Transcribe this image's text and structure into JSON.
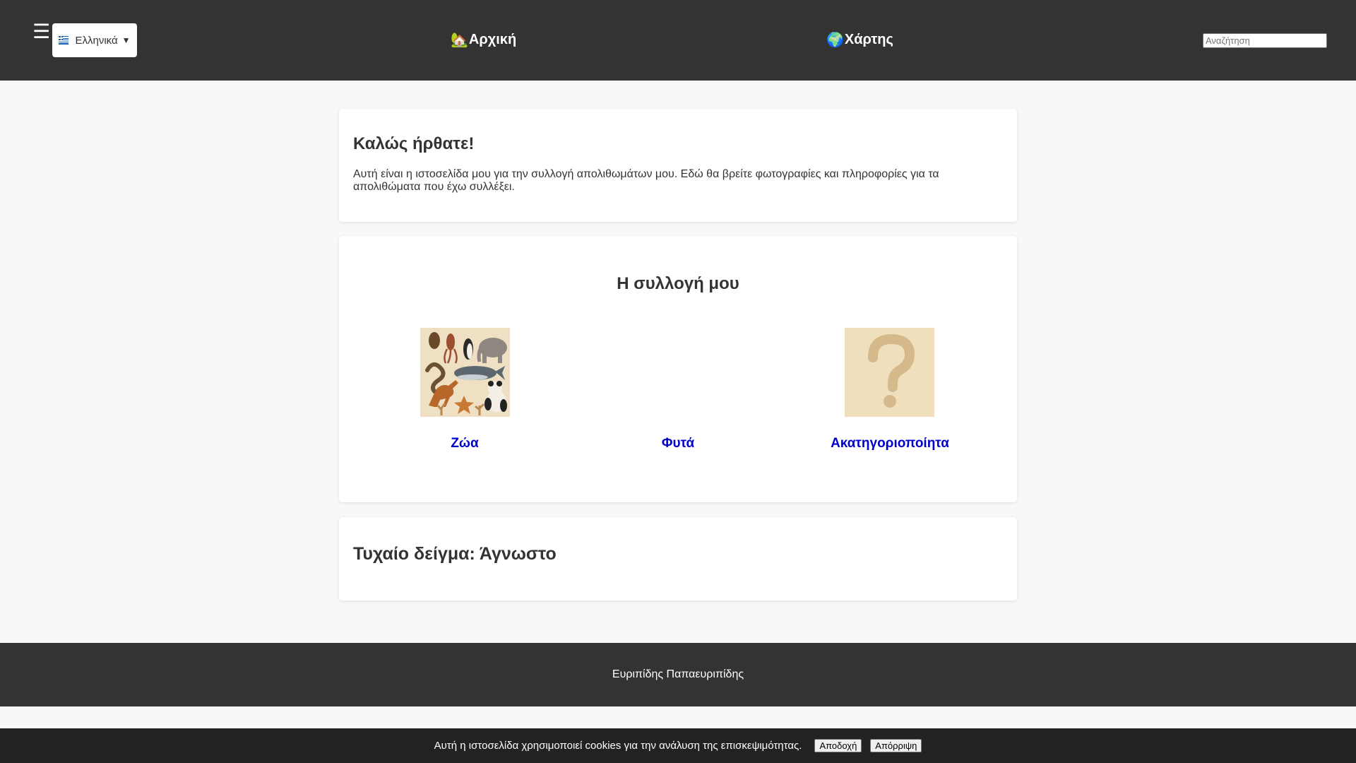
{
  "header": {
    "language": "Ελληνικά",
    "nav": {
      "home_label": "Αρχική",
      "home_icon": "house-icon",
      "map_label": "Χάρτης",
      "map_icon": "globe-icon"
    },
    "search": {
      "placeholder": "Αναζήτηση"
    }
  },
  "welcome": {
    "title": "Καλώς ήρθατε!",
    "text": "Αυτή είναι η ιστοσελίδα μου για την συλλογή απολιθωμάτων μου. Εδώ θα βρείτε φωτογραφίες και πληροφορίες για τα απολιθώματα που έχω συλλέξει."
  },
  "collection": {
    "title": "Η συλλογή μου",
    "categories": [
      {
        "label": "Ζώα",
        "image": "animals-image"
      },
      {
        "label": "Φυτά",
        "image": ""
      },
      {
        "label": "Ακατηγοριοποίητα",
        "image": "question-mark-image"
      }
    ]
  },
  "random_sample": {
    "title": "Τυχαίο δείγμα: Άγνωστο"
  },
  "footer": {
    "author": "Ευριπίδης Παπαευριπίδης"
  },
  "cookie": {
    "message": "Αυτή η ιστοσελίδα χρησιμοποιεί cookies για την ανάλυση της επισκεψιμότητας.",
    "accept_label": "Αποδοχή",
    "reject_label": "Απόρριψη"
  },
  "colors": {
    "header_bg": "#333333",
    "link": "#0000cc",
    "page_bg": "#f8f8f8"
  }
}
